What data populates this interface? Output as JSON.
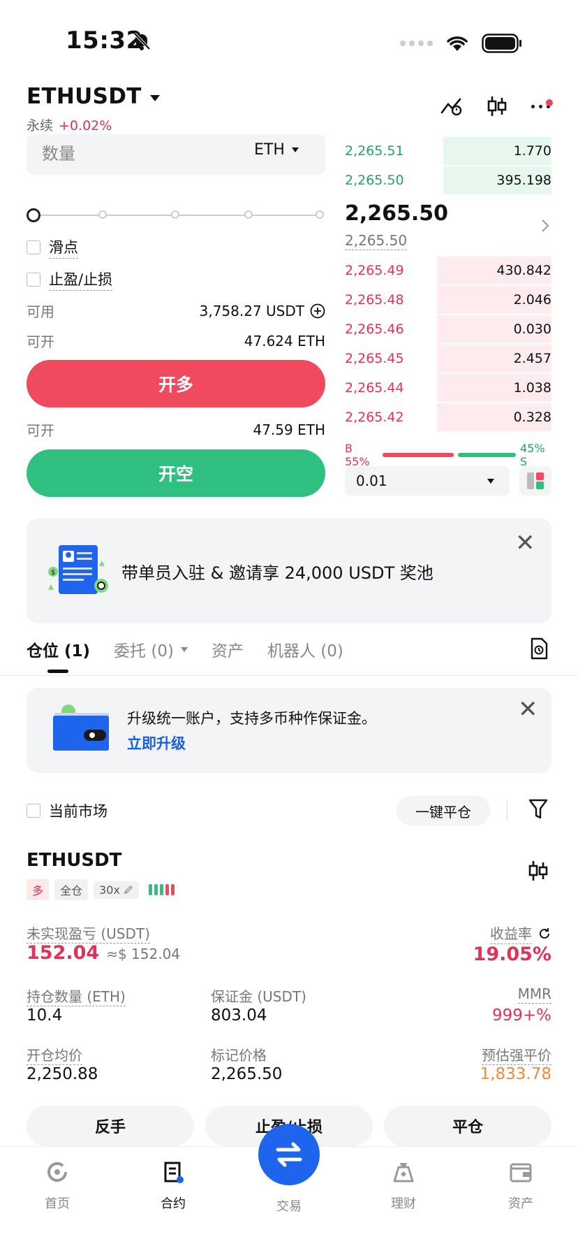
{
  "status_bar": {
    "time": "15:32"
  },
  "header": {
    "pair": "ETHUSDT",
    "type": "永续",
    "change": "+0.02%"
  },
  "order_form": {
    "qty_label": "数量",
    "qty_unit": "ETH",
    "slippage_label": "滑点",
    "tpsl_label": "止盈/止损",
    "available_label": "可用",
    "available_value": "3,758.27 USDT",
    "open_label": "可开",
    "open_long_value": "47.624 ETH",
    "long_button": "开多",
    "open_short_label": "可开",
    "open_short_value": "47.59 ETH",
    "short_button": "开空"
  },
  "orderbook": {
    "asks": [
      {
        "price": "2,265.51",
        "qty": "1.770"
      },
      {
        "price": "2,265.50",
        "qty": "395.198"
      }
    ],
    "last_price": "2,265.50",
    "mark_price": "2,265.50",
    "bids": [
      {
        "price": "2,265.49",
        "qty": "430.842"
      },
      {
        "price": "2,265.48",
        "qty": "2.046"
      },
      {
        "price": "2,265.46",
        "qty": "0.030"
      },
      {
        "price": "2,265.45",
        "qty": "2.457"
      },
      {
        "price": "2,265.44",
        "qty": "1.038"
      },
      {
        "price": "2,265.42",
        "qty": "0.328"
      }
    ],
    "buy_ratio": "B 55%",
    "sell_ratio": "45% S",
    "buy_pct": 55,
    "step": "0.01"
  },
  "promo": {
    "text": "带单员入驻 & 邀请享 24,000 USDT 奖池"
  },
  "tabs": [
    {
      "label": "仓位 (1)"
    },
    {
      "label": "委托 (0)"
    },
    {
      "label": "资产"
    },
    {
      "label": "机器人 (0)"
    }
  ],
  "upgrade": {
    "line1": "升级统一账户，支持多币种作保证金。",
    "link": "立即升级"
  },
  "filter": {
    "current_market": "当前市场",
    "close_all": "一键平仓"
  },
  "position": {
    "symbol": "ETHUSDT",
    "direction": "多",
    "margin_mode": "全仓",
    "leverage": "30x",
    "upnl_label": "未实现盈亏 (USDT)",
    "upnl_value": "152.04",
    "upnl_approx": "≈$ 152.04",
    "roe_label": "收益率",
    "roe_value": "19.05%",
    "size_label": "持仓数量 (ETH)",
    "size_value": "10.4",
    "margin_label": "保证金 (USDT)",
    "margin_value": "803.04",
    "mmr_label": "MMR",
    "mmr_value": "999+%",
    "entry_label": "开仓均价",
    "entry_value": "2,250.88",
    "mark_label": "标记价格",
    "mark_value": "2,265.50",
    "liq_label": "预估强平价",
    "liq_value": "1,833.78"
  },
  "actions": {
    "reverse": "反手",
    "tpsl": "止盈/止损",
    "close": "平仓"
  },
  "nav": [
    {
      "label": "首页"
    },
    {
      "label": "合约"
    },
    {
      "label": "交易"
    },
    {
      "label": "理财"
    },
    {
      "label": "资产"
    }
  ],
  "colors": {
    "long": "#ef4a5e",
    "short": "#2fbf7f",
    "accent": "#1f64ec",
    "orange": "#f08a3c"
  }
}
